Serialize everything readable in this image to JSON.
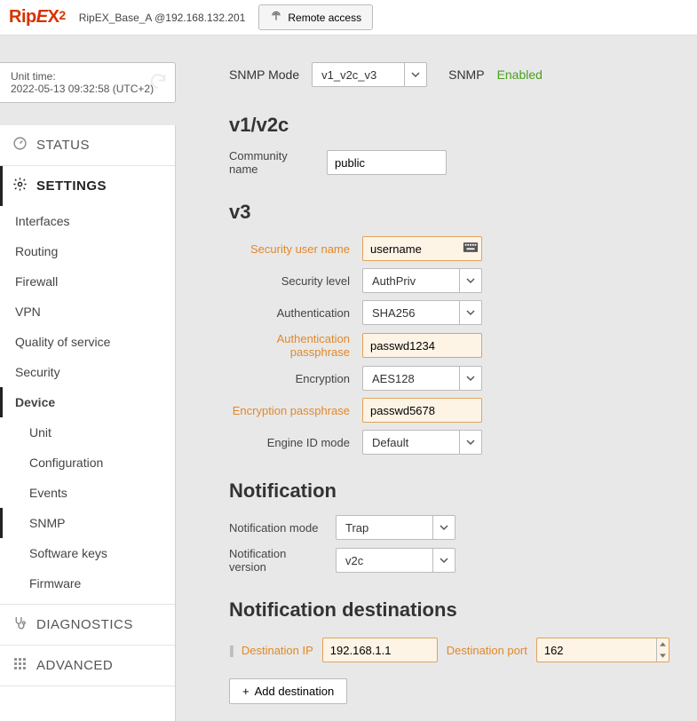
{
  "header": {
    "logo_text": "RipEX2",
    "address": "RipEX_Base_A @192.168.132.201",
    "remote_access": "Remote access"
  },
  "time": {
    "label": "Unit time:",
    "value": "2022-05-13 09:32:58 (UTC+2)"
  },
  "nav": {
    "status": "STATUS",
    "settings": "SETTINGS",
    "settings_items": {
      "interfaces": "Interfaces",
      "routing": "Routing",
      "firewall": "Firewall",
      "vpn": "VPN",
      "qos": "Quality of service",
      "security": "Security",
      "device": "Device",
      "unit": "Unit",
      "configuration": "Configuration",
      "events": "Events",
      "snmp": "SNMP",
      "swkeys": "Software keys",
      "firmware": "Firmware"
    },
    "diagnostics": "DIAGNOSTICS",
    "advanced": "ADVANCED"
  },
  "main": {
    "snmp_mode_label": "SNMP Mode",
    "snmp_mode_value": "v1_v2c_v3",
    "snmp_label": "SNMP",
    "snmp_status": "Enabled",
    "v1v2c": {
      "heading": "v1/v2c",
      "community_label": "Community name",
      "community_value": "public"
    },
    "v3": {
      "heading": "v3",
      "user_label": "Security user name",
      "user_value": "username",
      "level_label": "Security level",
      "level_value": "AuthPriv",
      "auth_label": "Authentication",
      "auth_value": "SHA256",
      "auth_pass_label": "Authentication passphrase",
      "auth_pass_value": "passwd1234",
      "enc_label": "Encryption",
      "enc_value": "AES128",
      "enc_pass_label": "Encryption passphrase",
      "enc_pass_value": "passwd5678",
      "engine_label": "Engine ID mode",
      "engine_value": "Default"
    },
    "notif": {
      "heading": "Notification",
      "mode_label": "Notification mode",
      "mode_value": "Trap",
      "ver_label": "Notification version",
      "ver_value": "v2c"
    },
    "dest": {
      "heading": "Notification destinations",
      "ip_label": "Destination IP",
      "ip_value": "192.168.1.1",
      "port_label": "Destination port",
      "port_value": "162",
      "add_label": "Add destination"
    }
  }
}
